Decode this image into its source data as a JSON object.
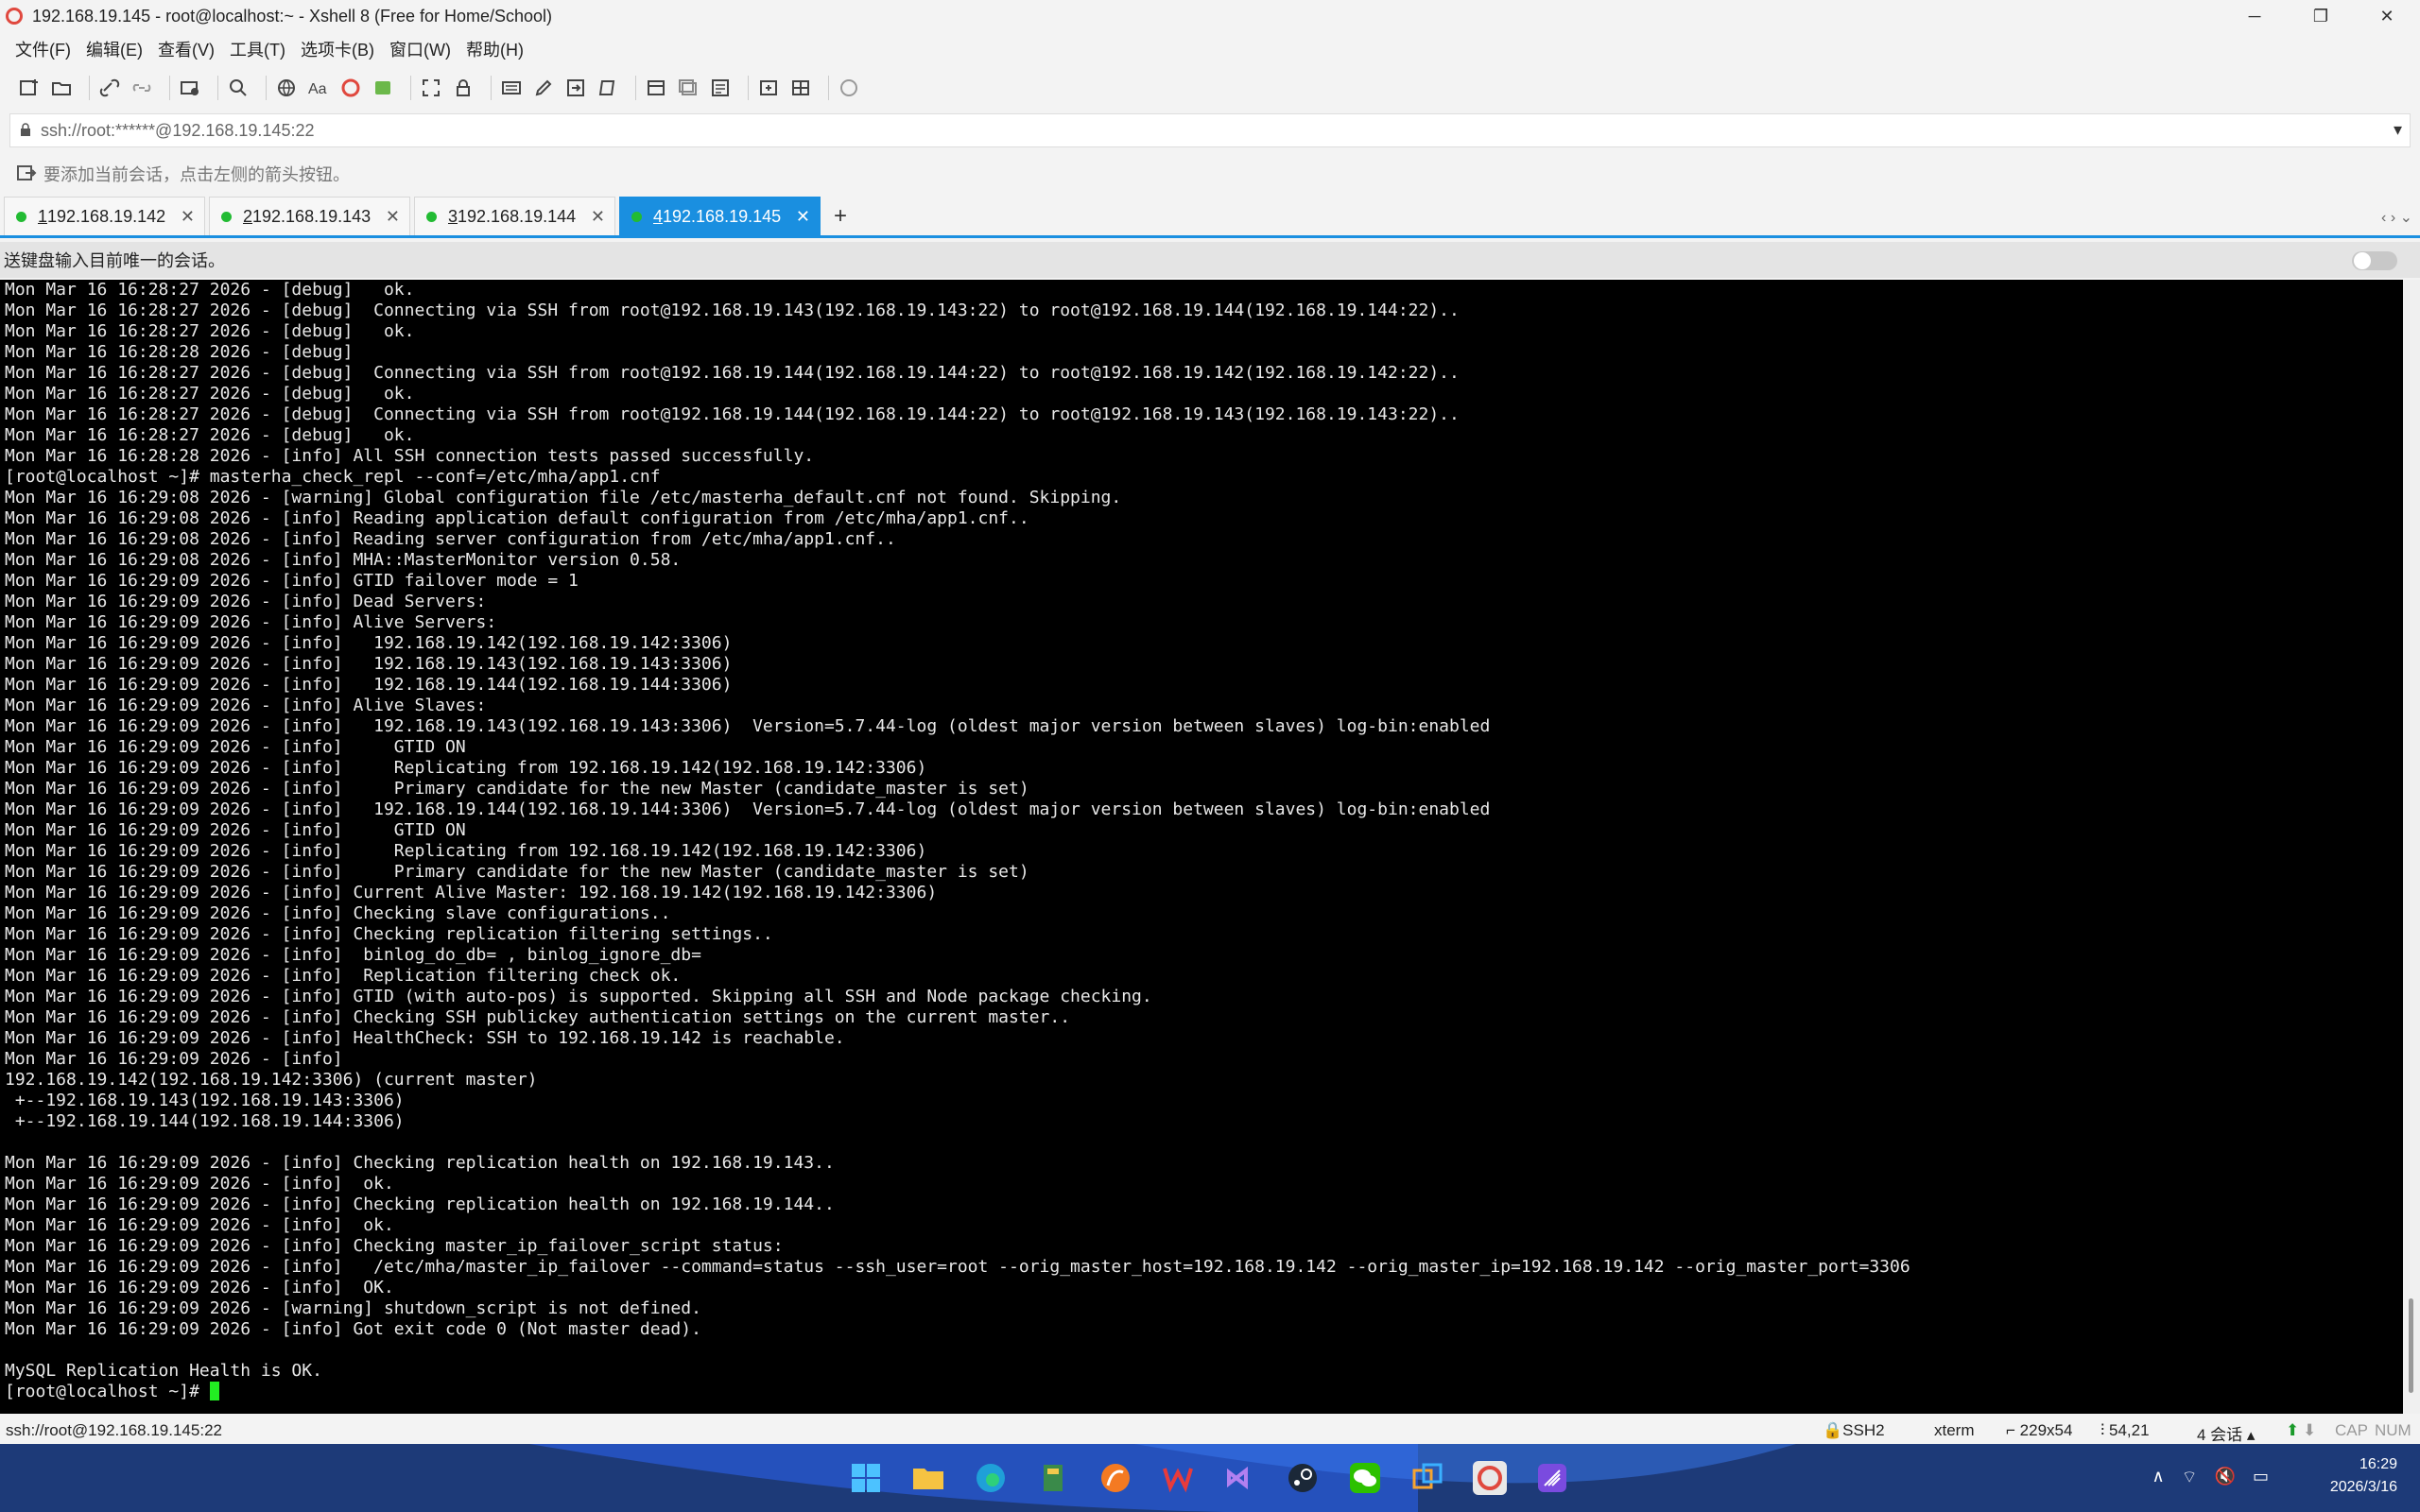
{
  "window": {
    "title": "192.168.19.145 - root@localhost:~ - Xshell 8 (Free for Home/School)",
    "controls": {
      "minimize": "─",
      "maximize": "❐",
      "close": "✕"
    }
  },
  "menu": [
    "文件(F)",
    "编辑(E)",
    "查看(V)",
    "工具(T)",
    "选项卡(B)",
    "窗口(W)",
    "帮助(H)"
  ],
  "address": {
    "value": "ssh://root:******@192.168.19.145:22",
    "dropdown": "▾"
  },
  "hint": "要添加当前会话，点击左侧的箭头按钮。",
  "tabs": [
    {
      "num": "1",
      "label": " 192.168.19.142",
      "active": false
    },
    {
      "num": "2",
      "label": " 192.168.19.143",
      "active": false
    },
    {
      "num": "3",
      "label": " 192.168.19.144",
      "active": false
    },
    {
      "num": "4",
      "label": " 192.168.19.145",
      "active": true
    }
  ],
  "tab_add": "+",
  "tab_nav": "‹  ›  ⌄",
  "send_bar": "送键盘输入目前唯一的会话。",
  "terminal": {
    "lines": [
      "Mon Mar 16 16:28:27 2026 - [debug]   ok.",
      "Mon Mar 16 16:28:27 2026 - [debug]  Connecting via SSH from root@192.168.19.143(192.168.19.143:22) to root@192.168.19.144(192.168.19.144:22)..",
      "Mon Mar 16 16:28:27 2026 - [debug]   ok.",
      "Mon Mar 16 16:28:28 2026 - [debug]",
      "Mon Mar 16 16:28:27 2026 - [debug]  Connecting via SSH from root@192.168.19.144(192.168.19.144:22) to root@192.168.19.142(192.168.19.142:22)..",
      "Mon Mar 16 16:28:27 2026 - [debug]   ok.",
      "Mon Mar 16 16:28:27 2026 - [debug]  Connecting via SSH from root@192.168.19.144(192.168.19.144:22) to root@192.168.19.143(192.168.19.143:22)..",
      "Mon Mar 16 16:28:27 2026 - [debug]   ok.",
      "Mon Mar 16 16:28:28 2026 - [info] All SSH connection tests passed successfully.",
      "[root@localhost ~]# masterha_check_repl --conf=/etc/mha/app1.cnf",
      "Mon Mar 16 16:29:08 2026 - [warning] Global configuration file /etc/masterha_default.cnf not found. Skipping.",
      "Mon Mar 16 16:29:08 2026 - [info] Reading application default configuration from /etc/mha/app1.cnf..",
      "Mon Mar 16 16:29:08 2026 - [info] Reading server configuration from /etc/mha/app1.cnf..",
      "Mon Mar 16 16:29:08 2026 - [info] MHA::MasterMonitor version 0.58.",
      "Mon Mar 16 16:29:09 2026 - [info] GTID failover mode = 1",
      "Mon Mar 16 16:29:09 2026 - [info] Dead Servers:",
      "Mon Mar 16 16:29:09 2026 - [info] Alive Servers:",
      "Mon Mar 16 16:29:09 2026 - [info]   192.168.19.142(192.168.19.142:3306)",
      "Mon Mar 16 16:29:09 2026 - [info]   192.168.19.143(192.168.19.143:3306)",
      "Mon Mar 16 16:29:09 2026 - [info]   192.168.19.144(192.168.19.144:3306)",
      "Mon Mar 16 16:29:09 2026 - [info] Alive Slaves:",
      "Mon Mar 16 16:29:09 2026 - [info]   192.168.19.143(192.168.19.143:3306)  Version=5.7.44-log (oldest major version between slaves) log-bin:enabled",
      "Mon Mar 16 16:29:09 2026 - [info]     GTID ON",
      "Mon Mar 16 16:29:09 2026 - [info]     Replicating from 192.168.19.142(192.168.19.142:3306)",
      "Mon Mar 16 16:29:09 2026 - [info]     Primary candidate for the new Master (candidate_master is set)",
      "Mon Mar 16 16:29:09 2026 - [info]   192.168.19.144(192.168.19.144:3306)  Version=5.7.44-log (oldest major version between slaves) log-bin:enabled",
      "Mon Mar 16 16:29:09 2026 - [info]     GTID ON",
      "Mon Mar 16 16:29:09 2026 - [info]     Replicating from 192.168.19.142(192.168.19.142:3306)",
      "Mon Mar 16 16:29:09 2026 - [info]     Primary candidate for the new Master (candidate_master is set)",
      "Mon Mar 16 16:29:09 2026 - [info] Current Alive Master: 192.168.19.142(192.168.19.142:3306)",
      "Mon Mar 16 16:29:09 2026 - [info] Checking slave configurations..",
      "Mon Mar 16 16:29:09 2026 - [info] Checking replication filtering settings..",
      "Mon Mar 16 16:29:09 2026 - [info]  binlog_do_db= , binlog_ignore_db=",
      "Mon Mar 16 16:29:09 2026 - [info]  Replication filtering check ok.",
      "Mon Mar 16 16:29:09 2026 - [info] GTID (with auto-pos) is supported. Skipping all SSH and Node package checking.",
      "Mon Mar 16 16:29:09 2026 - [info] Checking SSH publickey authentication settings on the current master..",
      "Mon Mar 16 16:29:09 2026 - [info] HealthCheck: SSH to 192.168.19.142 is reachable.",
      "Mon Mar 16 16:29:09 2026 - [info]",
      "192.168.19.142(192.168.19.142:3306) (current master)",
      " +--192.168.19.143(192.168.19.143:3306)",
      " +--192.168.19.144(192.168.19.144:3306)",
      "",
      "Mon Mar 16 16:29:09 2026 - [info] Checking replication health on 192.168.19.143..",
      "Mon Mar 16 16:29:09 2026 - [info]  ok.",
      "Mon Mar 16 16:29:09 2026 - [info] Checking replication health on 192.168.19.144..",
      "Mon Mar 16 16:29:09 2026 - [info]  ok.",
      "Mon Mar 16 16:29:09 2026 - [info] Checking master_ip_failover_script status:",
      "Mon Mar 16 16:29:09 2026 - [info]   /etc/mha/master_ip_failover --command=status --ssh_user=root --orig_master_host=192.168.19.142 --orig_master_ip=192.168.19.142 --orig_master_port=3306",
      "Mon Mar 16 16:29:09 2026 - [info]  OK.",
      "Mon Mar 16 16:29:09 2026 - [warning] shutdown_script is not defined.",
      "Mon Mar 16 16:29:09 2026 - [info] Got exit code 0 (Not master dead).",
      "",
      "MySQL Replication Health is OK."
    ],
    "prompt": "[root@localhost ~]# "
  },
  "status": {
    "connection": "ssh://root@192.168.19.145:22",
    "protocol": "SSH2",
    "terminal_type": "xterm",
    "size": "229x54",
    "cursor_pos": "54,21",
    "sessions": "4 会话",
    "caps": "CAP",
    "num": "NUM"
  },
  "taskbar": {
    "time": "16:29",
    "date": "2026/3/16"
  },
  "colors": {
    "accent": "#1a8fe0",
    "terminal_bg": "#000000",
    "cursor": "#22ee22",
    "taskbar": "#1d3a78"
  }
}
